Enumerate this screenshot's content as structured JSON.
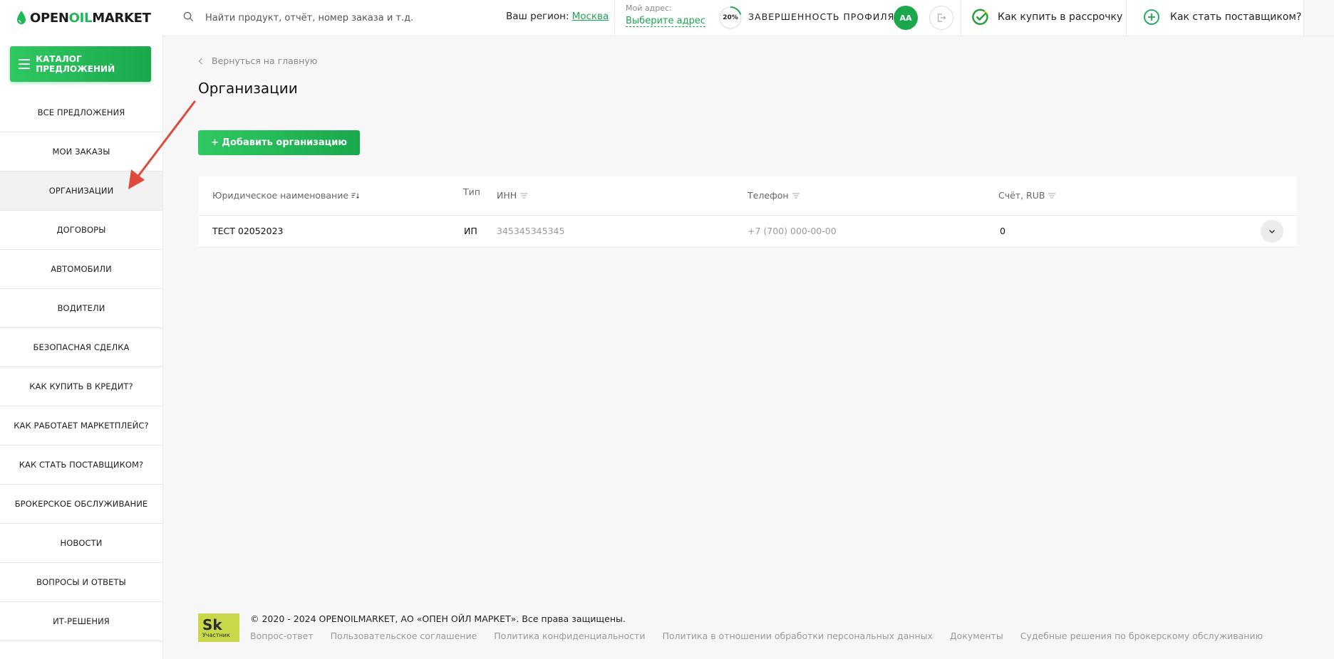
{
  "logo": {
    "part1": "OPEN",
    "part2": "OIL",
    "part3": "MARKET"
  },
  "sidebar": {
    "catalog_label": "КАТАЛОГ ПРЕДЛОЖЕНИЙ",
    "items": [
      {
        "label": "ВСЕ ПРЕДЛОЖЕНИЯ"
      },
      {
        "label": "МОИ ЗАКАЗЫ"
      },
      {
        "label": "ОРГАНИЗАЦИИ",
        "active": true
      },
      {
        "label": "ДОГОВОРЫ"
      },
      {
        "label": "АВТОМОБИЛИ"
      },
      {
        "label": "ВОДИТЕЛИ"
      },
      {
        "label": "БЕЗОПАСНАЯ СДЕЛКА"
      },
      {
        "label": "КАК КУПИТЬ В КРЕДИТ?"
      },
      {
        "label": "КАК РАБОТАЕТ МАРКЕТПЛЕЙС?"
      },
      {
        "label": "КАК СТАТЬ ПОСТАВЩИКОМ?"
      },
      {
        "label": "БРОКЕРСКОЕ ОБСЛУЖИВАНИЕ"
      },
      {
        "label": "НОВОСТИ"
      },
      {
        "label": "ВОПРОСЫ И ОТВЕТЫ"
      },
      {
        "label": "ИТ-РЕШЕНИЯ"
      }
    ]
  },
  "header": {
    "search_placeholder": "Найти продукт, отчёт, номер заказа и т.д.",
    "region_label": "Ваш регион:",
    "region_value": "Москва",
    "address_label": "Мой адрес:",
    "address_link": "Выберите адрес",
    "profile_percent": "20%",
    "profile_progress": 0.2,
    "profile_label": "ЗАВЕРШЕННОСТЬ ПРОФИЛЯ",
    "avatar_initials": "АА",
    "installment_label": "Как купить в рассрочку",
    "supplier_label": "Как стать поставщиком?"
  },
  "main": {
    "back_label": "Вернуться на главную",
    "title": "Организации",
    "add_button": "+ Добавить организацию",
    "table": {
      "columns": {
        "name": "Юридическое наименование",
        "type": "Тип",
        "inn": "ИНН",
        "phone": "Телефон",
        "account": "Счёт, RUB"
      },
      "rows": [
        {
          "name": "ТЕСТ 02052023",
          "type": "ИП",
          "inn": "345345345345",
          "phone": "+7 (700) 000-00-00",
          "account": "0"
        }
      ]
    }
  },
  "footer": {
    "copyright": "© 2020 - 2024 OPENOILMARKET, АО «ОПЕН ОЙЛ МАРКЕТ». Все права защищены.",
    "sk_big": "Sk",
    "sk_small": "Участник",
    "links": [
      "Вопрос-ответ",
      "Пользовательское соглашение",
      "Политика конфиденциальности",
      "Политика в отношении обработки персональных данных",
      "Документы",
      "Судебные решения по брокерскому обслуживанию"
    ]
  },
  "colors": {
    "accent": "#1aa84d",
    "arrow": "#e04a3a"
  }
}
